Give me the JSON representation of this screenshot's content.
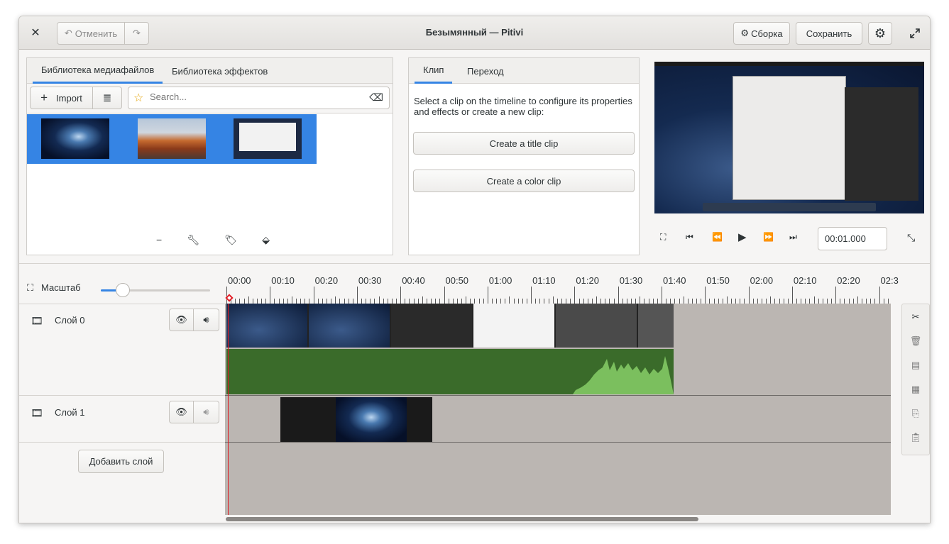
{
  "window": {
    "title": "Безымянный — Pitivi"
  },
  "headerbar": {
    "undo_label": "Отменить",
    "render_label": "Сборка",
    "save_label": "Сохранить"
  },
  "media_library": {
    "tabs": [
      "Библиотека медиафайлов",
      "Библиотека эффектов"
    ],
    "import_label": "Import",
    "search_placeholder": "Search...",
    "thumbnails": [
      "galaxy",
      "mountains",
      "desktop-screenshot"
    ]
  },
  "clip_panel": {
    "tabs": [
      "Клип",
      "Переход"
    ],
    "hint": "Select a clip on the timeline to configure its properties and effects or create a new clip:",
    "create_title_clip": "Create a title clip",
    "create_color_clip": "Create a color clip"
  },
  "viewer": {
    "timecode": "00:01.000"
  },
  "timeline": {
    "zoom_label": "Масштаб",
    "zoom_level": 0.2,
    "ruler_labels": [
      "00:00",
      "00:10",
      "00:20",
      "00:30",
      "00:40",
      "00:50",
      "01:00",
      "01:10",
      "01:20",
      "01:30",
      "01:40",
      "01:50",
      "02:00",
      "02:10",
      "02:20",
      "02:3"
    ],
    "layers": [
      {
        "name": "Слой 0"
      },
      {
        "name": "Слой 1"
      }
    ],
    "add_layer_label": "Добавить слой"
  },
  "colors": {
    "accent": "#3584e4",
    "audio_green": "#3a6b2a",
    "playhead": "#e01b24",
    "timeline_bg": "#bbb6b2"
  }
}
